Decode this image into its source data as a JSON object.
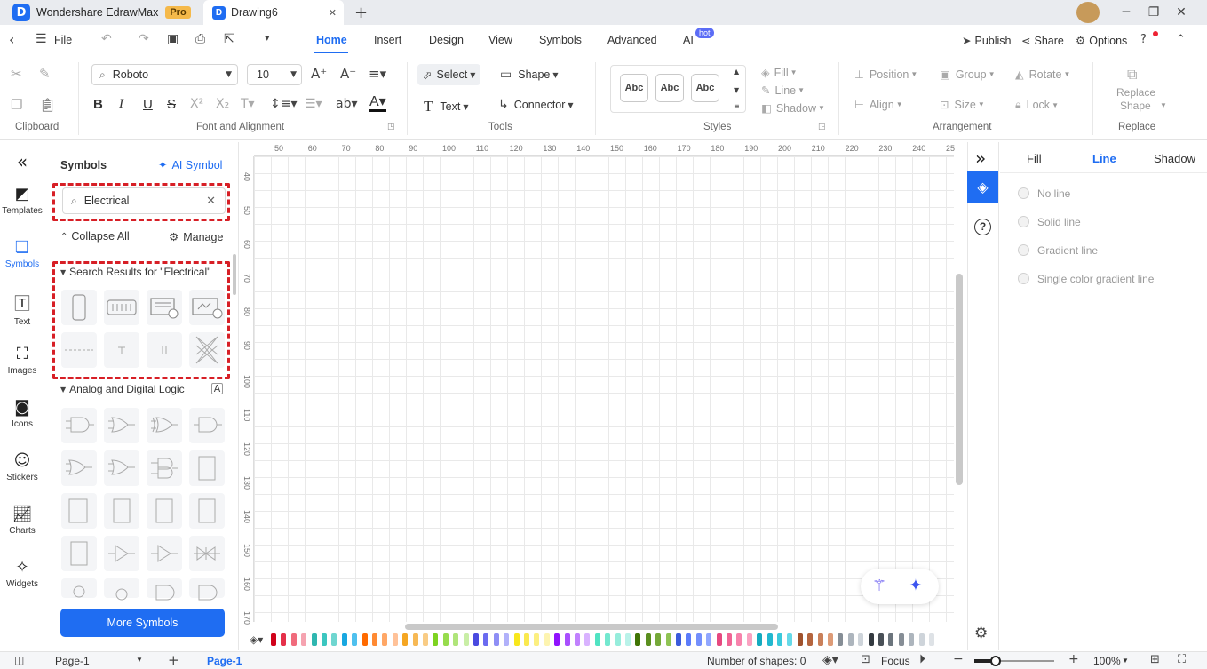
{
  "titlebar": {
    "app_name": "Wondershare EdrawMax",
    "pro_badge": "Pro",
    "doc_tab": "Drawing6",
    "doc_icon": "D",
    "app_logo": "D",
    "close_tab": "✕",
    "new_tab": "+"
  },
  "menubar": {
    "file": "File",
    "items": [
      "Home",
      "Insert",
      "Design",
      "View",
      "Symbols",
      "Advanced",
      "AI"
    ],
    "active": "Home",
    "hot_badge": "hot",
    "publish": "Publish",
    "share": "Share",
    "options": "Options"
  },
  "ribbon": {
    "font_name": "Roboto",
    "font_size": "10",
    "select": "Select",
    "shape": "Shape",
    "text": "Text",
    "connector": "Connector",
    "style_samples": [
      "Abc",
      "Abc",
      "Abc"
    ],
    "fill": "Fill",
    "line": "Line",
    "shadow": "Shadow",
    "position": "Position",
    "group": "Group",
    "rotate": "Rotate",
    "align": "Align",
    "size": "Size",
    "lock": "Lock",
    "replace_shape_1": "Replace",
    "replace_shape_2": "Shape",
    "groups": {
      "clipboard": "Clipboard",
      "font": "Font and Alignment",
      "tools": "Tools",
      "styles": "Styles",
      "arrangement": "Arrangement",
      "replace": "Replace"
    }
  },
  "leftnav": {
    "items": [
      {
        "label": "Templates",
        "icon": "templates-icon"
      },
      {
        "label": "Symbols",
        "icon": "symbols-icon"
      },
      {
        "label": "Text",
        "icon": "text-icon"
      },
      {
        "label": "Images",
        "icon": "images-icon"
      },
      {
        "label": "Icons",
        "icon": "icons-icon"
      },
      {
        "label": "Stickers",
        "icon": "stickers-icon"
      },
      {
        "label": "Charts",
        "icon": "charts-icon"
      },
      {
        "label": "Widgets",
        "icon": "widgets-icon"
      }
    ],
    "active": "Symbols"
  },
  "symbols": {
    "title": "Symbols",
    "ai_symbol": "AI Symbol",
    "search_value": "Electrical",
    "collapse_all": "Collapse All",
    "manage": "Manage",
    "search_results": "Search Results for  \"Electrical\"",
    "library": "Analog and Digital Logic",
    "more": "More Symbols"
  },
  "ruler": {
    "top": [
      "50",
      "60",
      "70",
      "80",
      "90",
      "100",
      "110",
      "120",
      "130",
      "140",
      "150",
      "160",
      "170",
      "180",
      "190",
      "200",
      "210",
      "220",
      "230",
      "240",
      "25"
    ],
    "left": [
      "40",
      "50",
      "60",
      "70",
      "80",
      "90",
      "100",
      "110",
      "120",
      "130",
      "140",
      "150",
      "160",
      "170"
    ]
  },
  "rightpanel": {
    "tabs": [
      "Fill",
      "Line",
      "Shadow"
    ],
    "active": "Line",
    "options": [
      "No line",
      "Solid line",
      "Gradient line",
      "Single color gradient line"
    ]
  },
  "statusbar": {
    "page_select": "Page-1",
    "page_tab": "Page-1",
    "shapes": "Number of shapes: 0",
    "focus": "Focus",
    "zoom": "100%"
  },
  "colors": {
    "accent": "#1f6df2",
    "highlight": "#d71f26",
    "palette": [
      "#d0021b",
      "#e5304a",
      "#f06b7c",
      "#f5a3b0",
      "#2fb6b0",
      "#3cc6c0",
      "#6fd6d0",
      "#19a7e0",
      "#4fc0ee",
      "#ff6a00",
      "#ff8a33",
      "#ffa766",
      "#ffc299",
      "#f5a623",
      "#f7b955",
      "#f9cc85",
      "#7ed321",
      "#97dc4d",
      "#b0e57a",
      "#c9eea6",
      "#4a4ae0",
      "#6b6bf0",
      "#8e8ef5",
      "#b1b1fa",
      "#f8e71c",
      "#fae94f",
      "#fcef80",
      "#fdf4b0",
      "#9013fe",
      "#a94ffe",
      "#c181fe",
      "#d9b3ff",
      "#50e3c2",
      "#73e8cf",
      "#96eddc",
      "#b9f2e9",
      "#417505",
      "#5b8f1f",
      "#75a939",
      "#8fc353",
      "#3b5bdb",
      "#5c7cfa",
      "#748ffc",
      "#91a7ff",
      "#e64980",
      "#f06595",
      "#f783ac",
      "#faa2c1",
      "#15aabf",
      "#22b8cf",
      "#3bc9db",
      "#66d9e8",
      "#a0522d",
      "#b5653e",
      "#c9805a",
      "#dd9b77",
      "#868e96",
      "#adb5bd",
      "#ced4da",
      "#343a40",
      "#495057",
      "#6c757d",
      "#868e96",
      "#adb5bd",
      "#ced4da",
      "#dee2e6"
    ]
  }
}
